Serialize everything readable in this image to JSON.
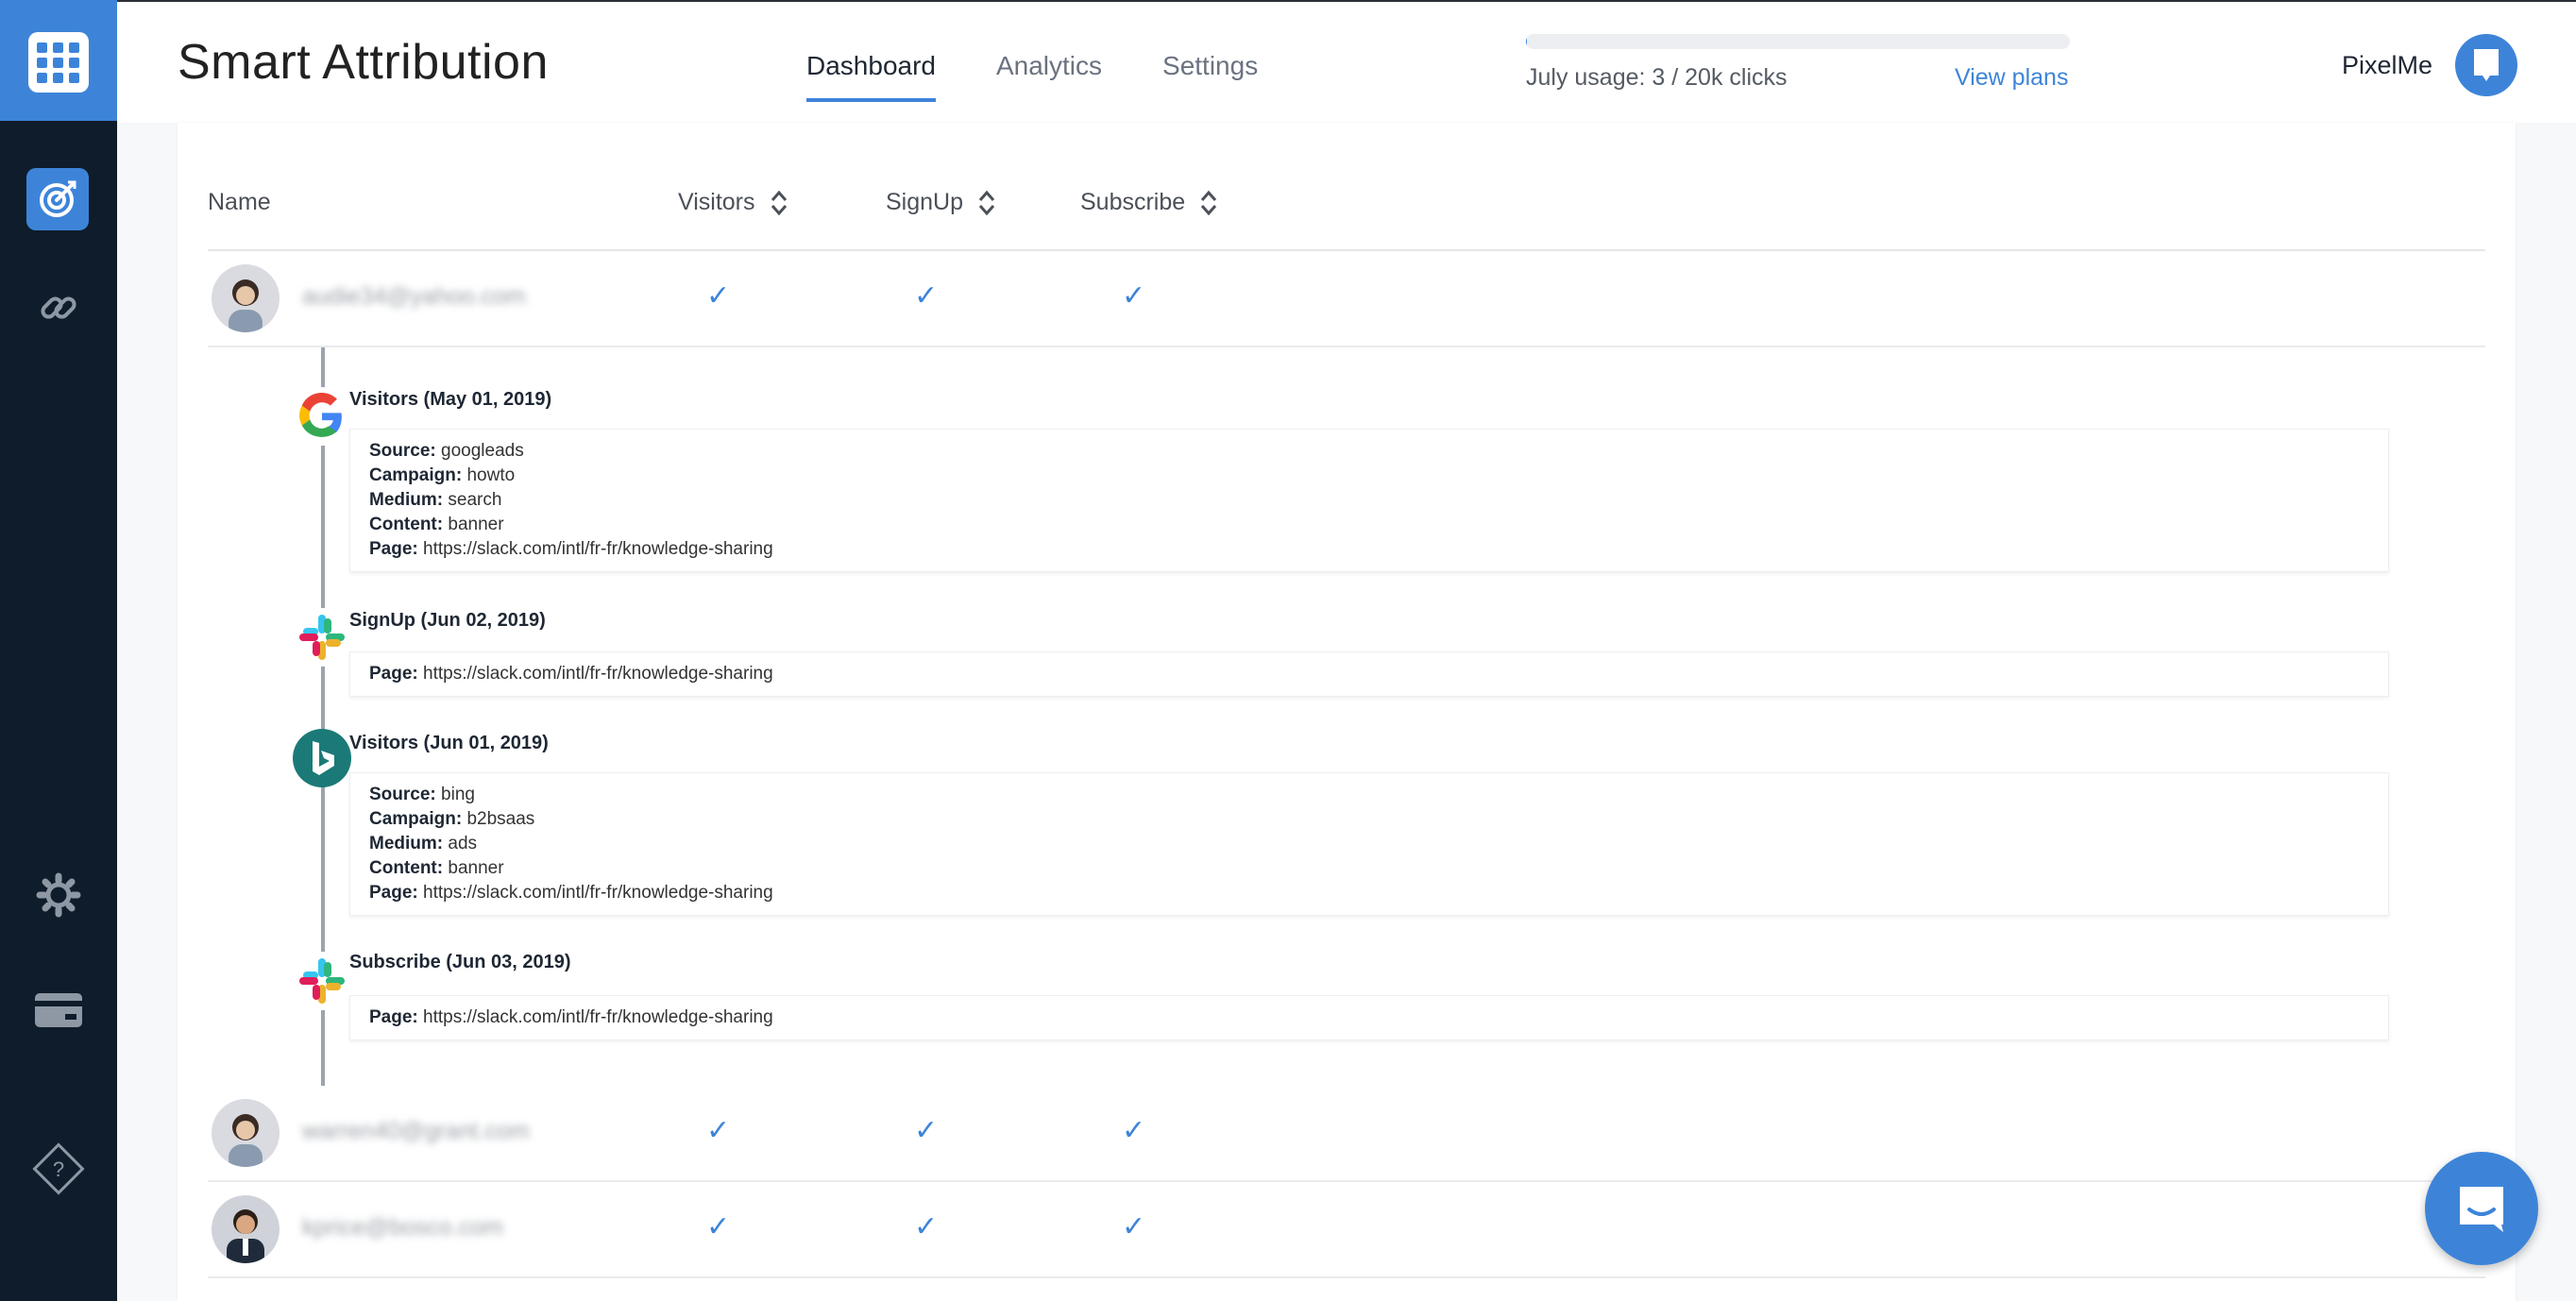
{
  "app": {
    "title": "Smart Attribution"
  },
  "nav": {
    "tabs": [
      {
        "label": "Dashboard",
        "active": true
      },
      {
        "label": "Analytics"
      },
      {
        "label": "Settings"
      }
    ]
  },
  "usage": {
    "text": "July usage: 3 / 20k clicks",
    "fraction": 0.00015,
    "view_plans": "View plans"
  },
  "account": {
    "name": "PixelMe"
  },
  "sidebar": {
    "icons": [
      "grid-logo-icon",
      "target-icon",
      "link-icon",
      "gear-icon",
      "credit-card-icon",
      "help-icon"
    ]
  },
  "table": {
    "columns": [
      {
        "label": "Name"
      },
      {
        "label": "Visitors"
      },
      {
        "label": "SignUp"
      },
      {
        "label": "Subscribe"
      }
    ],
    "check_glyph": "✓",
    "rows": [
      {
        "email": "audie34@yahoo.com",
        "visitors": true,
        "signup": true,
        "subscribe": true,
        "expanded": true
      },
      {
        "email": "warren40@grant.com",
        "visitors": true,
        "signup": true,
        "subscribe": true
      },
      {
        "email": "kprice@bosco.com",
        "visitors": true,
        "signup": true,
        "subscribe": true
      }
    ]
  },
  "timeline": {
    "events": [
      {
        "icon": "google-icon",
        "title": "Visitors (May 01, 2019)",
        "lines": [
          {
            "k": "Source:",
            "v": "googleads"
          },
          {
            "k": "Campaign:",
            "v": "howto"
          },
          {
            "k": "Medium:",
            "v": "search"
          },
          {
            "k": "Content:",
            "v": "banner"
          },
          {
            "k": "Page:",
            "v": "https://slack.com/intl/fr-fr/knowledge-sharing"
          }
        ]
      },
      {
        "icon": "slack-icon",
        "title": "SignUp (Jun 02, 2019)",
        "lines": [
          {
            "k": "Page:",
            "v": "https://slack.com/intl/fr-fr/knowledge-sharing"
          }
        ]
      },
      {
        "icon": "bing-icon",
        "title": "Visitors (Jun 01, 2019)",
        "lines": [
          {
            "k": "Source:",
            "v": "bing"
          },
          {
            "k": "Campaign:",
            "v": "b2bsaas"
          },
          {
            "k": "Medium:",
            "v": "ads"
          },
          {
            "k": "Content:",
            "v": "banner"
          },
          {
            "k": "Page:",
            "v": "https://slack.com/intl/fr-fr/knowledge-sharing"
          }
        ]
      },
      {
        "icon": "slack-icon",
        "title": "Subscribe (Jun 03, 2019)",
        "lines": [
          {
            "k": "Page:",
            "v": "https://slack.com/intl/fr-fr/knowledge-sharing"
          }
        ]
      }
    ]
  },
  "colors": {
    "accent": "#3d84d9",
    "sidebar": "#0f1c2b",
    "check": "#3d84d9"
  }
}
